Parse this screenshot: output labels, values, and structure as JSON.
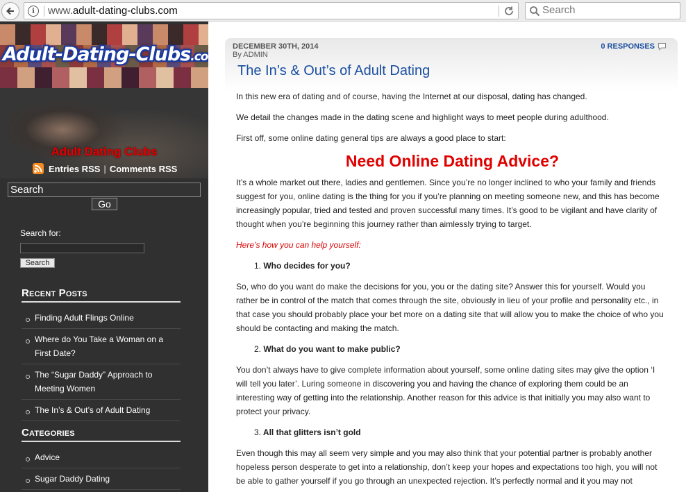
{
  "browser": {
    "url_prefix": "www.",
    "url_domain": "adult-dating-clubs.com",
    "search_placeholder": "Search"
  },
  "sidebar": {
    "logo_main": "Adult-Dating-Clubs",
    "logo_suffix": ".com",
    "site_title": "Adult Dating Clubs",
    "entries_rss": "Entries RSS",
    "separator": "|",
    "comments_rss": "Comments RSS",
    "search_value": "Search",
    "go_label": "Go",
    "search_for_label": "Search for:",
    "search_button": "Search",
    "recent_posts_title": "Recent Posts",
    "recent_posts": [
      "Finding Adult Flings Online",
      "Where do You Take a Woman on a First Date?",
      "The “Sugar Daddy” Approach to Meeting Women",
      "The In’s & Out’s of Adult Dating"
    ],
    "categories_title": "Categories",
    "categories": [
      "Advice",
      "Sugar Daddy Dating"
    ]
  },
  "post": {
    "date": "DECEMBER 30TH, 2014",
    "by_label": "By",
    "author": "ADMIN",
    "responses": "0 RESPONSES",
    "title": "The In’s & Out’s of Adult Dating",
    "p1": "In this new era of dating and of course, having the Internet at our disposal, dating has changed.",
    "p2": "We detail the changes made in the dating scene and highlight ways to meet people during adulthood.",
    "p3": "First off, some online dating general tips are always a good place to start:",
    "heading": "Need Online Dating Advice?",
    "p4": "It’s a whole market out there, ladies and gentlemen. Since you’re no longer inclined to who your family and friends suggest for you, online dating is the thing for you if you’re planning on meeting someone new, and this has become increasingly popular, tried and tested and proven successful many times. It’s good to be vigilant and have clarity of thought when you’re beginning this journey rather than aimlessly trying to target.",
    "help_line": "Here’s how you can help yourself:",
    "item1_num": "1.",
    "item1": "Who decides for you?",
    "p5": "So, who do you want do make the decisions for you, you or the dating site? Answer this for yourself. Would you rather be in control of the match that comes through the site, obviously in lieu of your profile and personality etc., in that case you should probably place your bet more on a dating site that will allow you to make the choice of who you should be contacting and making the match.",
    "item2_num": "2.",
    "item2": "What do you want to make public?",
    "p6": "You don’t always have to give complete information about yourself, some online dating sites may give the option ‘I will tell you later’. Luring someone in discovering you and having the chance of exploring them could be an interesting way of getting into the relationship. Another reason for this advice is that initially you may also want to protect your privacy.",
    "item3_num": "3.",
    "item3": "All that glitters isn’t gold",
    "p7": "Even though this may all seem very simple and you may also think that your potential partner is probably another hopeless person desperate to get into a relationship, don’t keep your hopes and expectations too high, you will not be able to gather yourself if you go through an unexpected rejection. It’s perfectly normal and it you may not"
  }
}
